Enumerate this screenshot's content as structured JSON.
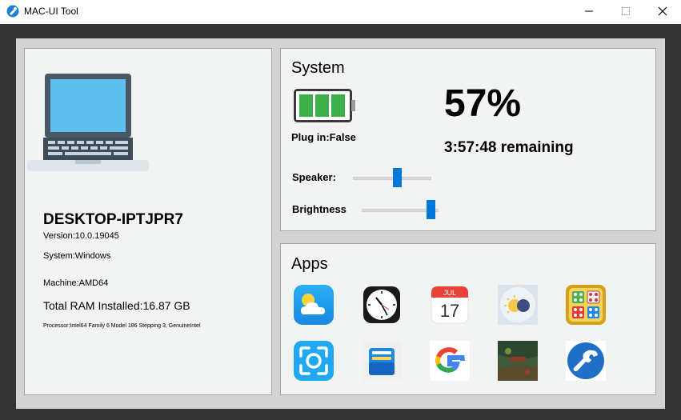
{
  "window": {
    "title": "MAC-UI Tool"
  },
  "device": {
    "name": "DESKTOP-IPTJPR7",
    "version": "Version:10.0.19045",
    "system": "System:Windows",
    "machine": "Machine:AMD64",
    "ram": "Total RAM Installed:16.87 GB",
    "processor": "Processor:Intel64 Family 6 Model 186 Stepping 3, GenuineIntel"
  },
  "system": {
    "heading": "System",
    "plug": "Plug in:False",
    "battery_percent": "57%",
    "remaining": "3:57:48 remaining",
    "speaker_label": "Speaker:",
    "speaker_level": 0.57,
    "brightness_label": "Brightness",
    "brightness_level": 0.95
  },
  "apps": {
    "heading": "Apps",
    "calendar_month": "JUL",
    "calendar_day": "17",
    "items": [
      "weather",
      "clock",
      "calendar",
      "weather-2",
      "ludo",
      "screenshot",
      "wallet",
      "google",
      "game",
      "settings"
    ]
  },
  "colors": {
    "accent": "#0078d7",
    "battery": "#3cb04b",
    "panel": "#f2f3f3"
  }
}
